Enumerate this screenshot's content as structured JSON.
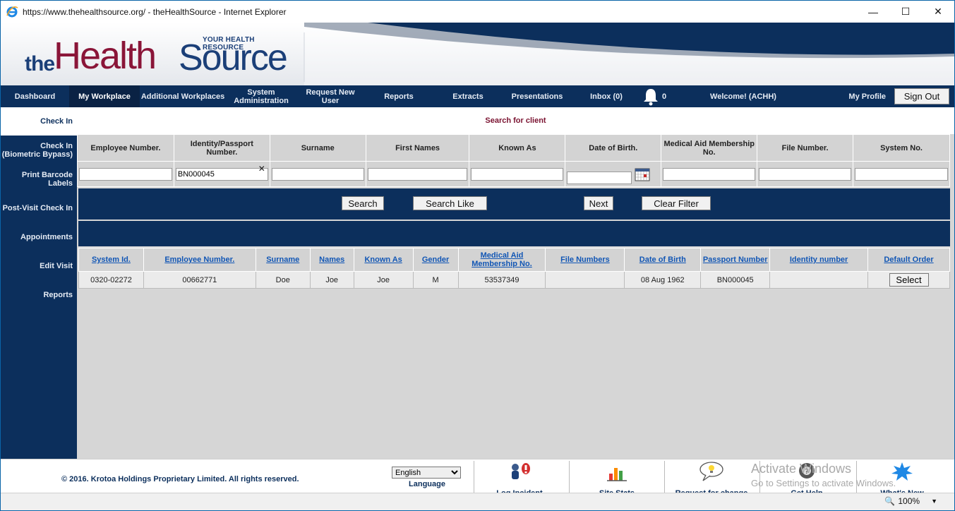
{
  "window": {
    "title": "https://www.thehealthsource.org/ - theHealthSource - Internet Explorer",
    "minimize": "—",
    "maximize": "☐",
    "close": "✕"
  },
  "logo": {
    "tagline": "YOUR HEALTH RESOURCE",
    "the": "the",
    "health": "Health",
    "source": "Source"
  },
  "topnav": {
    "dashboard": "Dashboard",
    "my_workplace": "My Workplace",
    "additional_workplaces": "Additional Workplaces",
    "system_administration": "System Administration",
    "request_new_user": "Request New User",
    "reports": "Reports",
    "extracts": "Extracts",
    "presentations": "Presentations",
    "inbox": "Inbox (0)",
    "notifications_count": "0",
    "welcome": "Welcome! (ACHH)",
    "my_profile": "My Profile",
    "sign_out": "Sign Out"
  },
  "sidebar": {
    "items": [
      {
        "label": "Check In"
      },
      {
        "label": "Check In (Biometric Bypass)"
      },
      {
        "label": "Print Barcode Labels"
      },
      {
        "label": "Post-Visit Check In"
      },
      {
        "label": "Appointments"
      },
      {
        "label": "Edit Visit"
      },
      {
        "label": "Reports"
      }
    ]
  },
  "search": {
    "title": "Search for client",
    "columns": [
      "Employee Number.",
      "Identity/Passport Number.",
      "Surname",
      "First Names",
      "Known As",
      "Date of Birth.",
      "Medical Aid Membership No.",
      "File Number.",
      "System No."
    ],
    "identity_value": "BN000045",
    "buttons": {
      "search": "Search",
      "search_like": "Search Like",
      "next": "Next",
      "clear_filter": "Clear Filter"
    }
  },
  "results": {
    "columns": [
      "System Id.",
      "Employee Number.",
      "Surname",
      "Names",
      "Known As",
      "Gender",
      "Medical Aid Membership No.",
      "File Numbers",
      "Date of Birth",
      "Passport Number",
      "Identity number",
      "Default Order"
    ],
    "rows": [
      {
        "system_id": "0320-02272",
        "employee_number": "00662771",
        "surname": "Doe",
        "names": "Joe",
        "known_as": "Joe",
        "gender": "M",
        "medical_aid": "53537349",
        "file_numbers": "",
        "date_of_birth": "08 Aug 1962",
        "passport_number": "BN000045",
        "identity_number": "",
        "action": "Select"
      }
    ]
  },
  "footer": {
    "copyright": "© 2016. Krotoa Holdings Proprietary Limited. All rights reserved.",
    "language_selected": "English",
    "language_label": "Language",
    "tools": [
      "Log Incident",
      "Site Stats",
      "Request for change",
      "Get Help",
      "What's New"
    ],
    "watermark_line1": "Activate Windows",
    "watermark_line2": "Go to Settings to activate Windows."
  },
  "statusbar": {
    "zoom": "100%"
  },
  "colors": {
    "navy": "#0c2f5c",
    "brand_red": "#8a1538",
    "link_blue": "#1156b5"
  }
}
